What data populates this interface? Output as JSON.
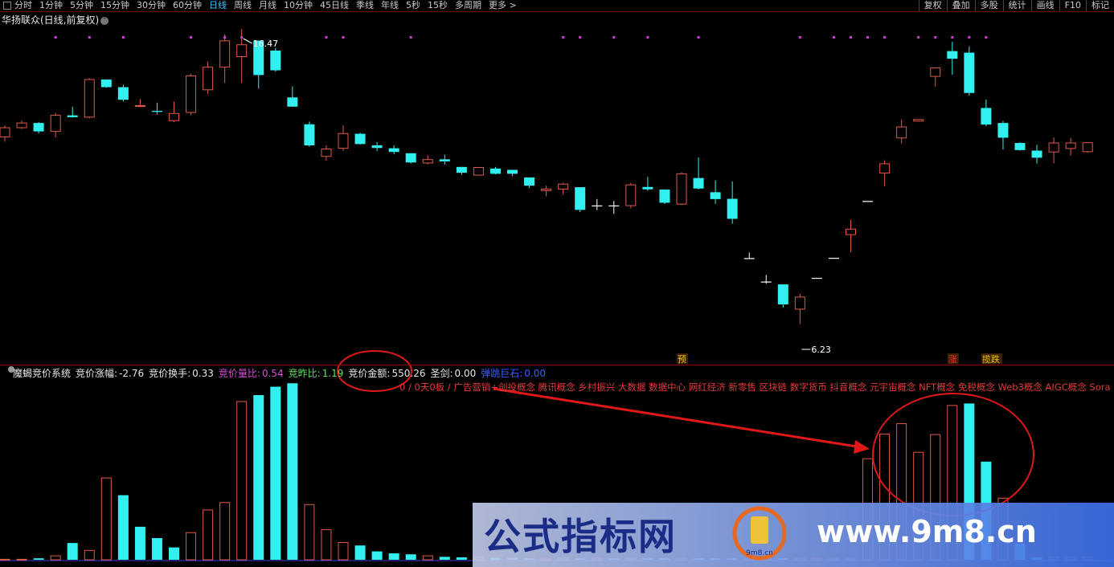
{
  "toolbar": {
    "periods": [
      "分时",
      "1分钟",
      "5分钟",
      "15分钟",
      "30分钟",
      "60分钟",
      "日线",
      "周线",
      "月线",
      "10分钟",
      "45日线",
      "季线",
      "年线",
      "5秒",
      "15秒",
      "多周期",
      "更多 >"
    ],
    "active_index": 6,
    "right": [
      "复权",
      "叠加",
      "多股",
      "统计",
      "画线",
      "F10",
      "标记"
    ]
  },
  "stock_title": "华扬联众(日线,前复权)",
  "indicator": {
    "name": "魔蝎竞价系统",
    "items": [
      {
        "label": "竞价涨幅:",
        "value": "-2.76",
        "color": "#e6e6e6"
      },
      {
        "label": "竞价换手:",
        "value": "0.33",
        "color": "#e6e6e6"
      },
      {
        "label": "竞价量比:",
        "value": "0.54",
        "color": "#d84bd8"
      },
      {
        "label": "竞昨比:",
        "value": "1.19",
        "color": "#5de05d"
      },
      {
        "label": "竞价金额:",
        "value": "550.26",
        "color": "#e6e6e6"
      },
      {
        "label": "圣剑:",
        "value": "0.00",
        "color": "#e6e6e6"
      },
      {
        "label": "弹跳巨石:",
        "value": "0.00",
        "color": "#3a5cff"
      }
    ]
  },
  "concepts": "0 / 0天0板 / 广告营销+创投概念 腾讯概念 乡村振兴 大数据 数据中心 网红经济 新零售 区块链 数字货币 抖音概念 元宇宙概念 NFT概念 免税概念 Web3概念 AIGC概念 Sora",
  "watermark": {
    "cn": "公式指标网",
    "url": "www.9m8.cn",
    "logo_text": "9m8.cn"
  },
  "colors": {
    "up": "#e05a4a",
    "down": "#33f0f0",
    "flat": "#ffffff",
    "marker": "#d23cd2",
    "arrow": "#e01818"
  },
  "chart_data": {
    "type": "candlestick",
    "ylim": [
      5.2,
      17.4
    ],
    "annotations": {
      "high": "16.47",
      "low": "6.23"
    },
    "signals": [
      {
        "index": 40,
        "label": "预",
        "color": "#f0c020"
      },
      {
        "index": 56,
        "label": "涨",
        "color": "#e03030"
      },
      {
        "index": 58,
        "label": "揽跌",
        "color": "#f0c020"
      }
    ],
    "ohlc": [
      [
        13.42,
        13.86,
        13.24,
        13.77
      ],
      [
        13.77,
        14.04,
        13.72,
        13.95
      ],
      [
        13.95,
        13.99,
        13.55,
        13.63
      ],
      [
        13.63,
        14.34,
        13.4,
        14.24
      ],
      [
        14.24,
        14.57,
        14.15,
        14.17
      ],
      [
        14.17,
        15.65,
        14.12,
        15.6
      ],
      [
        15.6,
        15.55,
        15.29,
        15.31
      ],
      [
        15.31,
        15.4,
        14.77,
        14.83
      ],
      [
        14.59,
        14.87,
        14.54,
        14.61
      ],
      [
        14.41,
        14.72,
        14.27,
        14.37
      ],
      [
        14.04,
        14.76,
        13.98,
        14.31
      ],
      [
        14.35,
        15.82,
        14.25,
        15.74
      ],
      [
        15.21,
        16.28,
        15.05,
        16.07
      ],
      [
        16.07,
        17.32,
        15.47,
        17.07
      ],
      [
        16.47,
        17.52,
        15.47,
        16.92
      ],
      [
        17.08,
        17.08,
        15.26,
        15.77
      ],
      [
        16.7,
        16.8,
        15.9,
        15.95
      ],
      [
        14.92,
        15.34,
        14.56,
        14.57
      ],
      [
        13.9,
        14.0,
        13.05,
        13.1
      ],
      [
        12.68,
        13.1,
        12.52,
        12.96
      ],
      [
        12.99,
        13.86,
        12.89,
        13.55
      ],
      [
        13.54,
        13.58,
        13.13,
        13.15
      ],
      [
        13.1,
        13.22,
        12.88,
        13.0
      ],
      [
        12.99,
        13.1,
        12.76,
        12.85
      ],
      [
        12.8,
        12.8,
        12.41,
        12.45
      ],
      [
        12.43,
        12.73,
        12.38,
        12.56
      ],
      [
        12.57,
        12.75,
        12.37,
        12.49
      ],
      [
        12.28,
        12.29,
        11.98,
        12.06
      ],
      [
        11.97,
        12.28,
        11.95,
        12.26
      ],
      [
        12.22,
        12.28,
        12.0,
        12.02
      ],
      [
        12.17,
        12.17,
        11.94,
        12.02
      ],
      [
        11.88,
        11.88,
        11.48,
        11.57
      ],
      [
        11.38,
        11.57,
        11.16,
        11.44
      ],
      [
        11.44,
        11.68,
        11.23,
        11.63
      ],
      [
        11.51,
        11.51,
        10.57,
        10.65
      ],
      [
        10.8,
        11.06,
        10.64,
        10.8
      ],
      [
        10.8,
        10.99,
        10.5,
        10.8
      ],
      [
        10.81,
        11.68,
        10.71,
        11.6
      ],
      [
        11.52,
        11.9,
        11.37,
        11.43
      ],
      [
        11.42,
        11.43,
        10.87,
        10.92
      ],
      [
        10.87,
        12.08,
        10.83,
        12.02
      ],
      [
        11.86,
        12.64,
        11.42,
        11.46
      ],
      [
        11.32,
        11.77,
        10.88,
        11.06
      ],
      [
        11.07,
        11.73,
        10.12,
        10.31
      ],
      [
        8.8,
        9.03,
        8.8,
        8.8
      ],
      [
        7.91,
        8.18,
        7.85,
        7.91
      ],
      [
        7.82,
        7.82,
        6.94,
        7.06
      ],
      [
        6.88,
        7.46,
        6.32,
        7.34
      ],
      [
        8.05,
        8.05,
        8.05,
        8.05
      ],
      [
        8.81,
        8.81,
        8.81,
        8.81
      ],
      [
        9.71,
        10.27,
        9.04,
        9.92
      ],
      [
        10.97,
        10.97,
        10.97,
        10.97
      ],
      [
        12.05,
        12.53,
        11.54,
        12.4
      ],
      [
        13.38,
        14.08,
        13.17,
        13.8
      ],
      [
        14.02,
        14.08,
        14.08,
        14.08
      ],
      [
        15.72,
        15.96,
        15.33,
        16.04
      ],
      [
        16.68,
        17.03,
        15.78,
        16.39
      ],
      [
        16.62,
        16.86,
        14.99,
        15.09
      ],
      [
        14.52,
        14.84,
        13.83,
        13.89
      ],
      [
        13.95,
        14.03,
        12.94,
        13.39
      ],
      [
        13.19,
        13.22,
        12.9,
        12.92
      ],
      [
        12.9,
        13.12,
        12.41,
        12.63
      ],
      [
        12.85,
        13.4,
        12.42,
        13.19
      ],
      [
        12.98,
        13.38,
        12.71,
        13.19
      ],
      [
        12.86,
        13.2,
        12.82,
        13.2
      ]
    ],
    "volume": [
      0.1,
      0.1,
      0.3,
      0.8,
      3.4,
      1.9,
      16.6,
      13.1,
      6.7,
      4.4,
      2.5,
      5.5,
      10.1,
      11.6,
      32.1,
      33.4,
      35.1,
      35.8,
      11.2,
      6.1,
      3.5,
      2.9,
      1.7,
      1.3,
      1.1,
      0.8,
      0.6,
      0.5,
      0.5,
      0.4,
      0.4,
      0.3,
      0.3,
      0.3,
      0.3,
      0.3,
      0.3,
      0.3,
      0.3,
      0.3,
      0.3,
      0.3,
      0.3,
      0.3,
      0.3,
      0.3,
      0.3,
      0.3,
      0.3,
      0.3,
      0.3,
      20.5,
      25.5,
      27.6,
      21.8,
      25.4,
      31.3,
      31.7,
      19.9,
      12.5,
      3.3,
      0.5,
      0.5,
      0.5,
      0.5
    ],
    "vol_up": [
      1,
      1,
      0,
      1,
      0,
      1,
      1,
      0,
      0,
      0,
      0,
      1,
      1,
      1,
      1,
      0,
      0,
      0,
      1,
      1,
      1,
      0,
      0,
      0,
      0,
      1,
      0,
      0,
      1,
      0,
      0,
      0,
      1,
      1,
      0,
      1,
      0,
      1,
      0,
      0,
      1,
      0,
      0,
      0,
      1,
      1,
      0,
      1,
      1,
      1,
      1,
      1,
      1,
      1,
      1,
      1,
      1,
      0,
      0,
      1,
      0,
      0,
      1,
      1,
      1
    ]
  }
}
